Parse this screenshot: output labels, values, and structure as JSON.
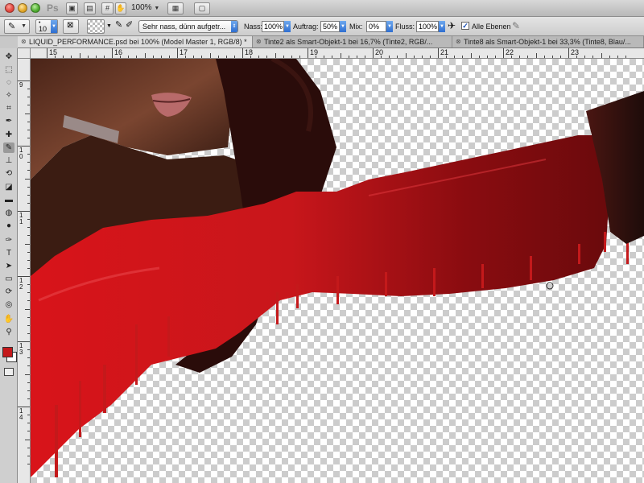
{
  "app": {
    "logo": "Ps",
    "zoom": "100%"
  },
  "options_bar": {
    "brush_size": "10",
    "preset": "Sehr nass, dünn aufgetr...",
    "nass_label": "Nass:",
    "nass_value": "100%",
    "auftrag_label": "Auftrag:",
    "auftrag_value": "50%",
    "mix_label": "Mix:",
    "mix_value": "0%",
    "fluss_label": "Fluss:",
    "fluss_value": "100%",
    "alle_ebenen_label": "Alle Ebenen",
    "alle_ebenen_checked": true
  },
  "tabs": [
    {
      "label": "LIQUID_PERFORMANCE.psd bei 100% (Model Master 1, RGB/8) *",
      "active": true
    },
    {
      "label": "Tinte2 als Smart-Objekt-1 bei 16,7% (Tinte2, RGB/...",
      "active": false
    },
    {
      "label": "Tinte8 als Smart-Objekt-1 bei 33,3% (Tinte8, Blau/...",
      "active": false
    }
  ],
  "ruler": {
    "h_labels": [
      "15",
      "16",
      "17",
      "18",
      "19",
      "20",
      "21",
      "22",
      "23"
    ],
    "v_labels": [
      "9",
      "1\n0",
      "1\n1",
      "1\n2",
      "1\n3",
      "1\n4"
    ]
  },
  "colors": {
    "foreground": "#c4191b",
    "background": "#ffffff",
    "accent": "#3a7ad8"
  }
}
